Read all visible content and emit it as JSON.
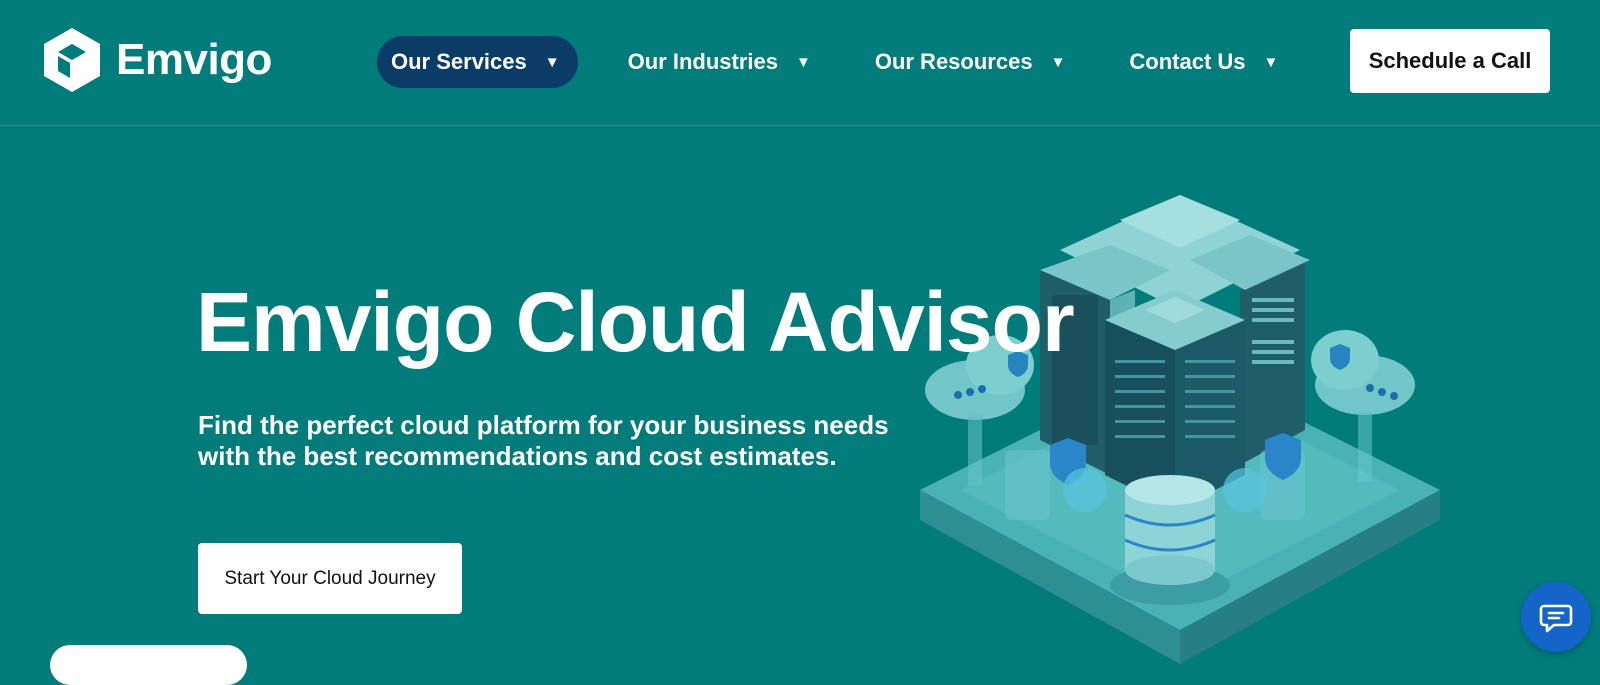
{
  "header": {
    "logo_text": "Emvigo",
    "logo_icon": "cube-logo-icon",
    "nav": [
      {
        "label": "Our Services",
        "active": true
      },
      {
        "label": "Our Industries",
        "active": false
      },
      {
        "label": "Our Resources",
        "active": false
      },
      {
        "label": "Contact Us",
        "active": false
      }
    ],
    "caret_glyph": "▼",
    "cta_label": "Schedule a Call"
  },
  "hero": {
    "title": "Emvigo Cloud Advisor",
    "subtitle": "Find the perfect cloud platform for your business needs with the best recommendations and cost estimates.",
    "cta_label": "Start Your Cloud Journey",
    "illustration": "isometric-server-cloud-illustration"
  },
  "chat": {
    "icon": "chat-bubble-icon"
  },
  "colors": {
    "background": "#017c7a",
    "nav_active": "#0b3c68",
    "button_bg": "#ffffff",
    "chat_button": "#1565c8"
  }
}
